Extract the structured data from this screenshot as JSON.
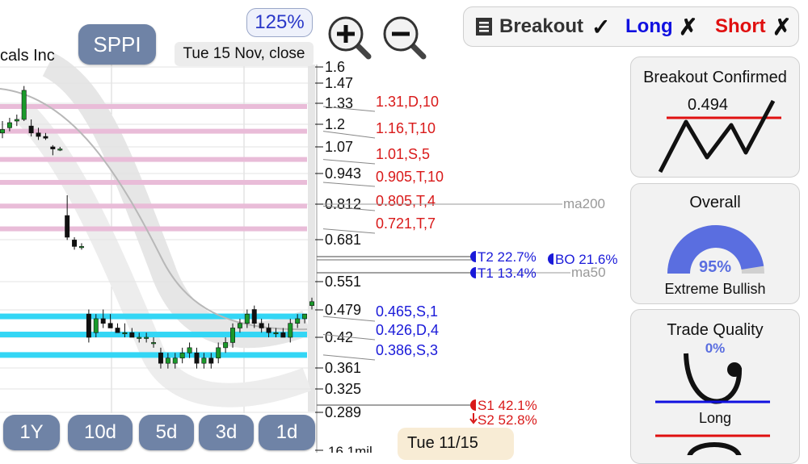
{
  "app": {
    "ticker": "SPPI",
    "company_fragment": "cals Inc",
    "zoom_level": "125%",
    "date_label": "Tue 15 Nov, close",
    "zoom_in_icon": "magnifier-plus-icon",
    "zoom_out_icon": "magnifier-minus-icon"
  },
  "period_buttons": [
    "1Y",
    "10d",
    "5d",
    "3d",
    "1d"
  ],
  "footer_date": "Tue 11/15",
  "topbar": {
    "breakout_icon": "list-icon",
    "breakout_label": "Breakout",
    "breakout_mark": "✓",
    "long_label": "Long",
    "long_mark": "✗",
    "short_label": "Short",
    "short_mark": "✗",
    "colors": {
      "long": "#1010e0",
      "short": "#e01010"
    }
  },
  "cards": {
    "breakout": {
      "title": "Breakout Confirmed",
      "value": "0.494"
    },
    "overall": {
      "title": "Overall",
      "percent": "95%",
      "percent_value": 95,
      "label": "Extreme Bullish"
    },
    "quality": {
      "title": "Trade Quality",
      "percent": "0%",
      "percent_value": 0,
      "label": "Long"
    }
  },
  "chart_data": {
    "type": "candlestick",
    "y_ticks": [
      "1.6",
      "1.47",
      "1.33",
      "1.2",
      "1.07",
      "0.943",
      "0.812",
      "0.681",
      "0.551",
      "0.479",
      "0.42",
      "0.361",
      "0.325",
      "0.289"
    ],
    "y_tick_values": [
      1.6,
      1.47,
      1.33,
      1.2,
      1.07,
      0.943,
      0.812,
      0.681,
      0.551,
      0.479,
      0.42,
      0.361,
      0.325,
      0.289
    ],
    "volume_label": "16.1mil",
    "resistance_levels": [
      {
        "label": "1.31,D,10",
        "value": 1.31
      },
      {
        "label": "1.16,T,10",
        "value": 1.16
      },
      {
        "label": "1.01,S,5",
        "value": 1.01
      },
      {
        "label": "0.905,T,10",
        "value": 0.905
      },
      {
        "label": "0.805,T,4",
        "value": 0.805
      },
      {
        "label": "0.721,T,7",
        "value": 0.721
      }
    ],
    "support_levels": [
      {
        "label": "0.465,S,1",
        "value": 0.465
      },
      {
        "label": "0.426,D,4",
        "value": 0.426
      },
      {
        "label": "0.386,S,3",
        "value": 0.386
      }
    ],
    "moving_averages": [
      {
        "name": "ma200",
        "value": 0.812
      },
      {
        "name": "ma50",
        "value": 0.585
      }
    ],
    "targets": [
      {
        "label": "T2 22.7%",
        "value": 0.608
      },
      {
        "label": "BO 21.6%",
        "value": 0.6
      },
      {
        "label": "T1 13.4%",
        "value": 0.585
      }
    ],
    "stops": [
      {
        "label": "S1 42.1%",
        "value": 0.295
      },
      {
        "label": "S2 52.8%",
        "value": 0.27
      }
    ],
    "colors": {
      "resistance": "#d91a1a",
      "support": "#1a1ad9",
      "res_band": "#e9bcd8",
      "sup_band": "#33d6f5",
      "up": "#1a9a2a",
      "down": "#111111"
    },
    "candles": [
      {
        "o": 1.15,
        "h": 1.22,
        "l": 1.12,
        "c": 1.17
      },
      {
        "o": 1.18,
        "h": 1.24,
        "l": 1.16,
        "c": 1.21
      },
      {
        "o": 1.22,
        "h": 1.26,
        "l": 1.19,
        "c": 1.23
      },
      {
        "o": 1.23,
        "h": 1.45,
        "l": 1.22,
        "c": 1.42
      },
      {
        "o": 1.19,
        "h": 1.23,
        "l": 1.13,
        "c": 1.15
      },
      {
        "o": 1.15,
        "h": 1.18,
        "l": 1.11,
        "c": 1.13
      },
      {
        "o": 1.13,
        "h": 1.15,
        "l": 1.11,
        "c": 1.12
      },
      {
        "o": 1.07,
        "h": 1.08,
        "l": 1.03,
        "c": 1.06
      },
      {
        "o": 1.06,
        "h": 1.07,
        "l": 1.05,
        "c": 1.06
      },
      {
        "o": 0.77,
        "h": 0.85,
        "l": 0.68,
        "c": 0.69
      },
      {
        "o": 0.68,
        "h": 0.69,
        "l": 0.65,
        "c": 0.66
      },
      {
        "o": 0.66,
        "h": 0.67,
        "l": 0.65,
        "c": 0.66
      },
      {
        "o": 0.47,
        "h": 0.48,
        "l": 0.41,
        "c": 0.42
      },
      {
        "o": 0.43,
        "h": 0.47,
        "l": 0.42,
        "c": 0.46
      },
      {
        "o": 0.46,
        "h": 0.48,
        "l": 0.44,
        "c": 0.45
      },
      {
        "o": 0.45,
        "h": 0.47,
        "l": 0.44,
        "c": 0.44
      },
      {
        "o": 0.44,
        "h": 0.45,
        "l": 0.43,
        "c": 0.43
      },
      {
        "o": 0.43,
        "h": 0.45,
        "l": 0.42,
        "c": 0.43
      },
      {
        "o": 0.43,
        "h": 0.44,
        "l": 0.42,
        "c": 0.42
      },
      {
        "o": 0.42,
        "h": 0.43,
        "l": 0.41,
        "c": 0.42
      },
      {
        "o": 0.42,
        "h": 0.43,
        "l": 0.41,
        "c": 0.42
      },
      {
        "o": 0.41,
        "h": 0.42,
        "l": 0.4,
        "c": 0.41
      },
      {
        "o": 0.39,
        "h": 0.4,
        "l": 0.36,
        "c": 0.37
      },
      {
        "o": 0.37,
        "h": 0.39,
        "l": 0.36,
        "c": 0.38
      },
      {
        "o": 0.37,
        "h": 0.39,
        "l": 0.36,
        "c": 0.38
      },
      {
        "o": 0.38,
        "h": 0.4,
        "l": 0.37,
        "c": 0.39
      },
      {
        "o": 0.39,
        "h": 0.41,
        "l": 0.38,
        "c": 0.4
      },
      {
        "o": 0.39,
        "h": 0.4,
        "l": 0.36,
        "c": 0.37
      },
      {
        "o": 0.37,
        "h": 0.39,
        "l": 0.36,
        "c": 0.38
      },
      {
        "o": 0.38,
        "h": 0.39,
        "l": 0.36,
        "c": 0.37
      },
      {
        "o": 0.38,
        "h": 0.41,
        "l": 0.37,
        "c": 0.4
      },
      {
        "o": 0.4,
        "h": 0.42,
        "l": 0.39,
        "c": 0.41
      },
      {
        "o": 0.41,
        "h": 0.45,
        "l": 0.4,
        "c": 0.44
      },
      {
        "o": 0.44,
        "h": 0.46,
        "l": 0.43,
        "c": 0.45
      },
      {
        "o": 0.45,
        "h": 0.48,
        "l": 0.44,
        "c": 0.47
      },
      {
        "o": 0.48,
        "h": 0.49,
        "l": 0.44,
        "c": 0.45
      },
      {
        "o": 0.45,
        "h": 0.46,
        "l": 0.43,
        "c": 0.44
      },
      {
        "o": 0.44,
        "h": 0.45,
        "l": 0.42,
        "c": 0.43
      },
      {
        "o": 0.43,
        "h": 0.44,
        "l": 0.42,
        "c": 0.43
      },
      {
        "o": 0.43,
        "h": 0.44,
        "l": 0.42,
        "c": 0.42
      },
      {
        "o": 0.42,
        "h": 0.46,
        "l": 0.41,
        "c": 0.45
      },
      {
        "o": 0.45,
        "h": 0.47,
        "l": 0.44,
        "c": 0.46
      },
      {
        "o": 0.46,
        "h": 0.47,
        "l": 0.45,
        "c": 0.47
      },
      {
        "o": 0.49,
        "h": 0.51,
        "l": 0.48,
        "c": 0.5
      }
    ]
  }
}
